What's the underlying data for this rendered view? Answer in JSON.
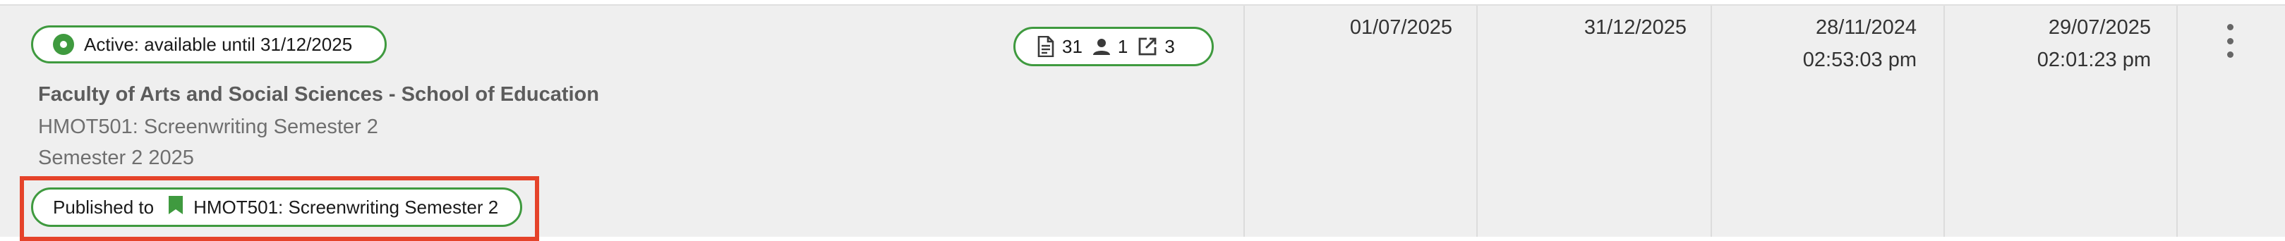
{
  "status": {
    "label": "Active: available until 31/12/2025"
  },
  "counts": {
    "documents": "31",
    "people": "1",
    "links": "3"
  },
  "course": {
    "faculty": "Faculty of Arts and Social Sciences - School of Education",
    "code_name": "HMOT501: Screenwriting Semester 2",
    "term": "Semester 2 2025"
  },
  "published": {
    "prefix": "Published to",
    "target": "HMOT501: Screenwriting Semester 2"
  },
  "columns": {
    "start_date": "01/07/2025",
    "end_date": "31/12/2025",
    "created_date": "28/11/2024",
    "created_time": "02:53:03 pm",
    "modified_date": "29/07/2025",
    "modified_time": "02:01:23 pm"
  },
  "icons": {
    "status": "status-dot-icon",
    "documents": "document-icon",
    "people": "person-icon",
    "links": "external-link-icon",
    "published": "bookmark-icon",
    "menu": "more-vertical-icon"
  },
  "colors": {
    "accent": "#3f9a3f",
    "highlight": "#e5432a",
    "row_bg": "#efefef"
  }
}
